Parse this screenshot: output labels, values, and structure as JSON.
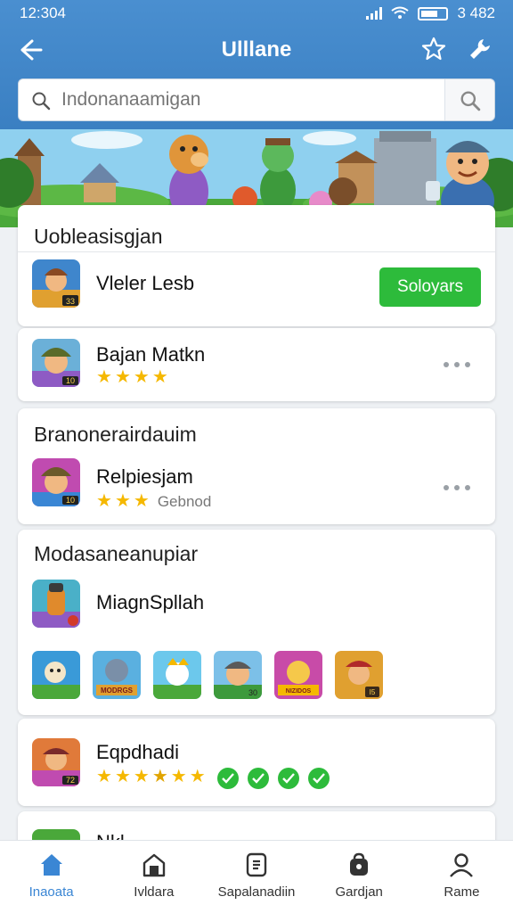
{
  "status_bar": {
    "time": "12:304",
    "right_text": "3 482"
  },
  "header": {
    "title": "Ulllane"
  },
  "search": {
    "placeholder": "Indonanaamigan"
  },
  "sections": [
    {
      "title": "Uobleasisgjan",
      "apps": [
        {
          "name": "Vleler Lesb",
          "button_label": "Soloyars",
          "icon_badge": "33"
        },
        {
          "name": "Bajan Matkn",
          "stars": 4,
          "icon_badge": "10"
        }
      ]
    },
    {
      "title": "Branonerairdauim",
      "apps": [
        {
          "name": "Relpiesjam",
          "stars": 3,
          "subtext": "Gebnod",
          "icon_badge": "10"
        }
      ]
    },
    {
      "title": "Modasaneanupiar",
      "apps": [
        {
          "name": "MiagnSpllah"
        }
      ],
      "thumbnails": [
        {
          "badge": ""
        },
        {
          "badge": "MODRGS"
        },
        {
          "badge": ""
        },
        {
          "badge": "30"
        },
        {
          "badge": "NIZIDOS"
        },
        {
          "badge": "I5"
        }
      ]
    },
    {
      "apps": [
        {
          "name": "Eqpdhadi",
          "stars": 5.5,
          "checks": 4,
          "icon_badge": "72"
        }
      ]
    },
    {
      "apps": [
        {
          "name": "Nkl"
        }
      ]
    }
  ],
  "bottom_nav": [
    {
      "label": "Inaoata",
      "icon": "home-icon",
      "active": true
    },
    {
      "label": "Ivldara",
      "icon": "store-icon",
      "active": false
    },
    {
      "label": "Sapalanadiin",
      "icon": "library-icon",
      "active": false
    },
    {
      "label": "Gardjan",
      "icon": "backpack-icon",
      "active": false
    },
    {
      "label": "Rame",
      "icon": "profile-icon",
      "active": false
    }
  ],
  "colors": {
    "header_blue": "#3a7fc2",
    "accent_green": "#2dbb3b",
    "star_yellow": "#f5b800",
    "active_tab": "#3a86d4"
  }
}
